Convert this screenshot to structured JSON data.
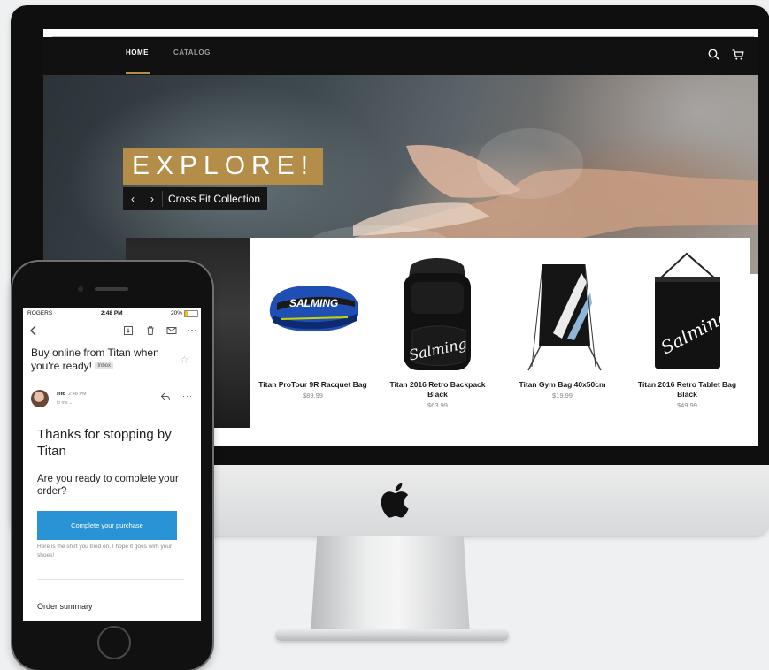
{
  "desktop": {
    "nav": {
      "items": [
        {
          "label": "HOME",
          "active": true
        },
        {
          "label": "CATALOG",
          "active": false
        }
      ]
    },
    "icons": {
      "search": "search-icon",
      "cart": "cart-icon"
    },
    "hero": {
      "headline": "EXPLORE!",
      "prev_label": "‹",
      "next_label": "›",
      "slide_title": "Cross Fit Collection"
    },
    "products": [
      {
        "name": "Titan ProTour 9R Racquet Bag",
        "price": "$89.99"
      },
      {
        "name": "Titan 2016 Retro Backpack Black",
        "price": "$63.99"
      },
      {
        "name": "Titan Gym Bag 40x50cm",
        "price": "$19.99"
      },
      {
        "name": "Titan 2016 Retro Tablet Bag Black",
        "price": "$49.99"
      }
    ],
    "colors": {
      "accent": "#b48e48",
      "nav_bg": "#111111"
    }
  },
  "phone": {
    "status": {
      "carrier": "ROGERS",
      "time": "2:48 PM",
      "battery": "20%"
    },
    "email": {
      "subject": "Buy online from Titan when you're ready!",
      "label": "Inbox",
      "sender": "me",
      "sent_time": "2:48 PM",
      "recipient": "to me ⌄",
      "title": "Thanks for stopping by Titan",
      "question": "Are you ready to complete your order?",
      "cta_label": "Complete your purchase",
      "note": "Here is the shirt you tried on. I hope it goes wirh your shoes!",
      "order_summary": "Order summary"
    },
    "colors": {
      "cta": "#2a93d5"
    }
  }
}
